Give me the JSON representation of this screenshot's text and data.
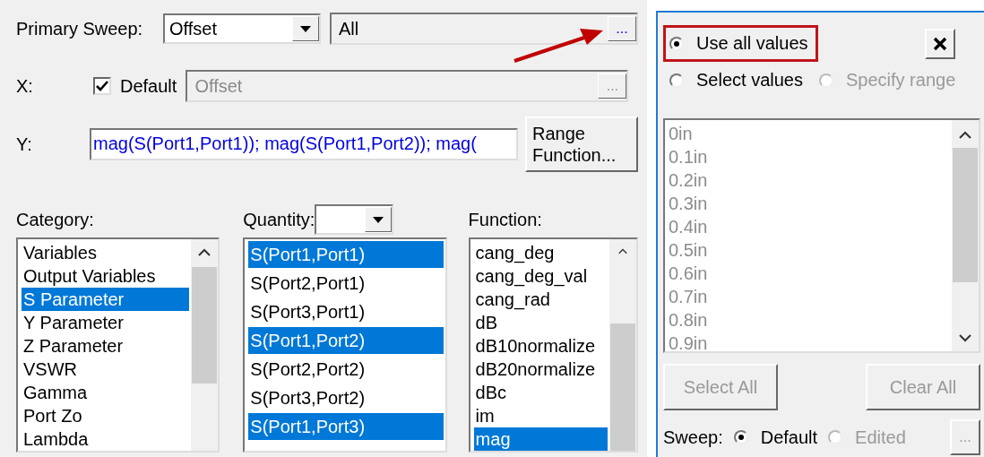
{
  "primary_sweep": {
    "label": "Primary Sweep:",
    "value": "Offset",
    "range": "All",
    "browse_button": "..."
  },
  "x": {
    "label": "X:",
    "default_checked": true,
    "default_label": "Default",
    "value": "Offset",
    "browse_button": "..."
  },
  "y": {
    "label": "Y:",
    "value": "mag(S(Port1,Port1)); mag(S(Port1,Port2)); mag(",
    "range_function_button": "Range Function..."
  },
  "category": {
    "label": "Category:",
    "items": [
      {
        "label": "Variables",
        "selected": false
      },
      {
        "label": "Output Variables",
        "selected": false
      },
      {
        "label": "S Parameter",
        "selected": true
      },
      {
        "label": "Y Parameter",
        "selected": false
      },
      {
        "label": "Z Parameter",
        "selected": false
      },
      {
        "label": "VSWR",
        "selected": false
      },
      {
        "label": "Gamma",
        "selected": false
      },
      {
        "label": "Port Zo",
        "selected": false
      },
      {
        "label": "Lambda",
        "selected": false
      }
    ]
  },
  "quantity": {
    "label": "Quantity:",
    "items": [
      {
        "label": "S(Port1,Port1)",
        "selected": true
      },
      {
        "label": "S(Port2,Port1)",
        "selected": false
      },
      {
        "label": "S(Port3,Port1)",
        "selected": false
      },
      {
        "label": "S(Port1,Port2)",
        "selected": true
      },
      {
        "label": "S(Port2,Port2)",
        "selected": false
      },
      {
        "label": "S(Port3,Port2)",
        "selected": false
      },
      {
        "label": "S(Port1,Port3)",
        "selected": true
      }
    ]
  },
  "function": {
    "label": "Function:",
    "items": [
      {
        "label": "cang_deg",
        "selected": false
      },
      {
        "label": "cang_deg_val",
        "selected": false
      },
      {
        "label": "cang_rad",
        "selected": false
      },
      {
        "label": "dB",
        "selected": false
      },
      {
        "label": "dB10normalize",
        "selected": false
      },
      {
        "label": "dB20normalize",
        "selected": false
      },
      {
        "label": "dBc",
        "selected": false
      },
      {
        "label": "im",
        "selected": false
      },
      {
        "label": "mag",
        "selected": true
      }
    ]
  },
  "values_panel": {
    "modes": [
      {
        "label": "Use all values",
        "selected": true,
        "disabled": false,
        "highlighted": true
      },
      {
        "label": "Select values",
        "selected": false,
        "disabled": false,
        "highlighted": false
      },
      {
        "label": "Specify range",
        "selected": false,
        "disabled": true,
        "highlighted": false
      }
    ],
    "values_list": {
      "disabled": true,
      "items": [
        "0in",
        "0.1in",
        "0.2in",
        "0.3in",
        "0.4in",
        "0.5in",
        "0.6in",
        "0.7in",
        "0.8in",
        "0.9in"
      ]
    },
    "buttons": [
      {
        "label": "Select All",
        "disabled": true
      },
      {
        "label": "Clear All",
        "disabled": true
      }
    ],
    "sweep": {
      "label": "Sweep:",
      "options": [
        {
          "label": "Default",
          "selected": true,
          "disabled": false
        },
        {
          "label": "Edited",
          "selected": false,
          "disabled": true
        }
      ],
      "browse_button": "..."
    }
  }
}
